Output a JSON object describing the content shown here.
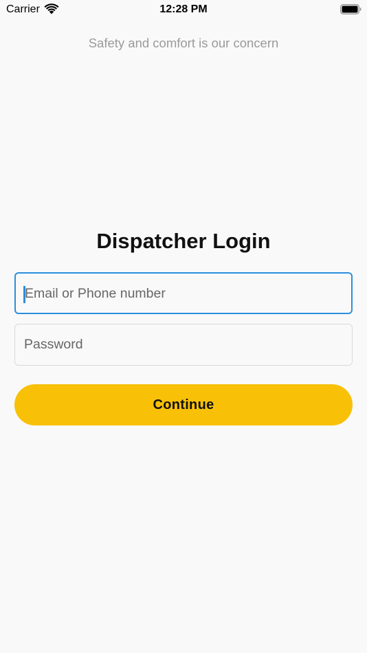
{
  "status_bar": {
    "carrier": "Carrier",
    "time": "12:28 PM"
  },
  "tagline": "Safety and comfort is our concern",
  "login": {
    "title": "Dispatcher Login",
    "email_placeholder": "Email or Phone number",
    "password_placeholder": "Password",
    "continue_label": "Continue"
  },
  "colors": {
    "accent": "#f8c108",
    "focus_border": "#2b8fdd",
    "background": "#f9f9f9"
  }
}
